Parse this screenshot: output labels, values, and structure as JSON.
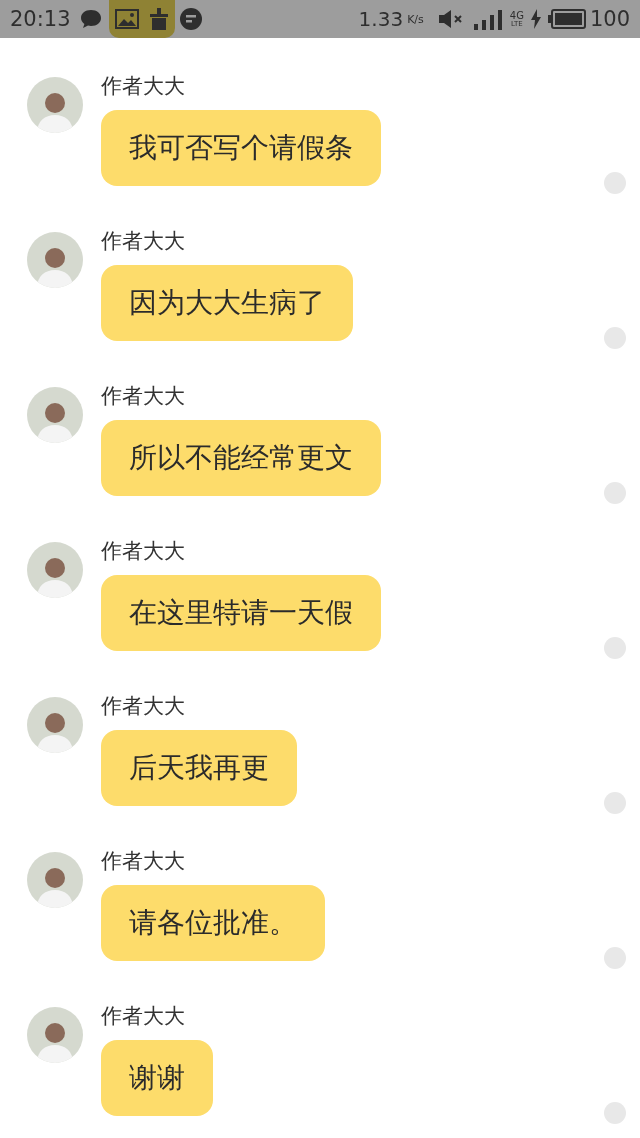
{
  "status_bar": {
    "time": "20:13",
    "speed": "1.33",
    "speed_unit": "K/s",
    "network": "4G",
    "network_sub": "LTE",
    "battery": "100"
  },
  "messages": [
    {
      "sender": "作者大大",
      "text": "我可否写个请假条"
    },
    {
      "sender": "作者大大",
      "text": "因为大大生病了"
    },
    {
      "sender": "作者大大",
      "text": "所以不能经常更文"
    },
    {
      "sender": "作者大大",
      "text": "在这里特请一天假"
    },
    {
      "sender": "作者大大",
      "text": "后天我再更"
    },
    {
      "sender": "作者大大",
      "text": "请各位批准。"
    },
    {
      "sender": "作者大大",
      "text": "谢谢"
    }
  ]
}
